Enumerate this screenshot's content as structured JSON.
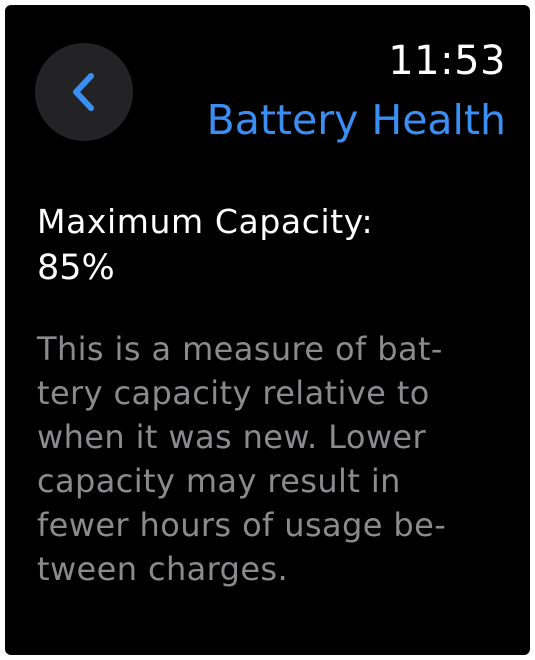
{
  "status_bar": {
    "time": "11:53"
  },
  "nav": {
    "back_icon": "chevron-left-icon",
    "title": "Battery Health"
  },
  "capacity": {
    "label": "Maximum Capacity:",
    "value": "85%"
  },
  "description": {
    "lines": [
      "This is a measure of bat-",
      "tery capacity relative to",
      "when it was new. Lower",
      "capacity may result in",
      "fewer hours of usage be-",
      "tween charges."
    ]
  },
  "colors": {
    "background": "#000000",
    "accent": "#3a8ff5",
    "primary_text": "#ffffff",
    "secondary_text": "#8b8b8e",
    "button_background": "#232325"
  }
}
